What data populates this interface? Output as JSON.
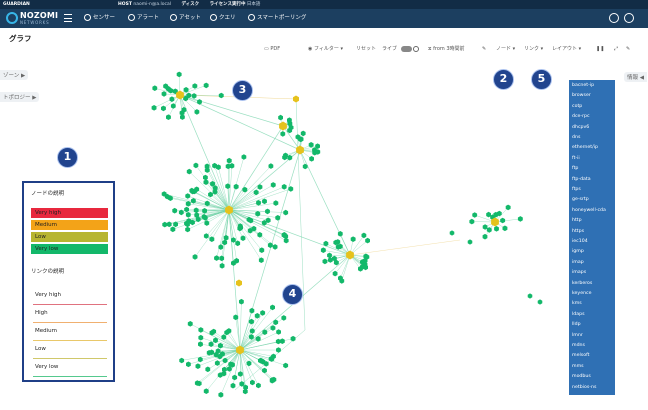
{
  "statusbar": {
    "brand": "GUARDIAN",
    "host_label": "HOST",
    "host_value": "naomi-n@a.local",
    "disk_label": "ディスク",
    "license_label": "ライセンス実行中",
    "language": "日本語"
  },
  "nav": {
    "logo_name": "NOZOMI",
    "logo_sub": "NETWORKS",
    "items": [
      {
        "label": "センサー",
        "icon": "sensor-icon"
      },
      {
        "label": "アラート",
        "icon": "alert-icon"
      },
      {
        "label": "アセット",
        "icon": "asset-icon"
      },
      {
        "label": "クエリ",
        "icon": "query-icon"
      },
      {
        "label": "スマートポーリング",
        "icon": "polling-icon"
      }
    ]
  },
  "page_title": "グラフ",
  "toolbar": {
    "pdf": "PDF",
    "filter": "フィルター ▾",
    "reset": "リセット",
    "live": "ライブ",
    "time": "from 3時間前",
    "node": "ノード ▾",
    "link": "リンク ▾",
    "layout": "レイアウト ▾"
  },
  "left_tabs": {
    "zone": "ゾーン ▶",
    "topology": "トポロジー ▶"
  },
  "right_tab": "情報 ◀",
  "protocols": [
    "bacnet-ip",
    "browser",
    "cotp",
    "dce-rpc",
    "dhcpv6",
    "dns",
    "ethernet/ip",
    "ft-ii",
    "ftp",
    "ftp-data",
    "ftps",
    "ge-srtp",
    "honeywell-cda",
    "http",
    "https",
    "iec104",
    "igmp",
    "imap",
    "imaps",
    "kerberos",
    "keyence",
    "kms",
    "ldaps",
    "lldp",
    "lmnr",
    "mdns",
    "melsoft",
    "mms",
    "modbus",
    "netbios-ns"
  ],
  "legend": {
    "node_title": "ノードの説明",
    "nodes": [
      {
        "label": "Very high",
        "color": "#e8283e"
      },
      {
        "label": "Medium",
        "color": "#f3a318"
      },
      {
        "label": "Low",
        "color": "#b7b530"
      },
      {
        "label": "Very low",
        "color": "#13b86a"
      }
    ],
    "link_title": "リンクの説明",
    "links": [
      {
        "label": "Very high",
        "color": "#e0727f"
      },
      {
        "label": "High",
        "color": "#f0b070"
      },
      {
        "label": "Medium",
        "color": "#e9c86a"
      },
      {
        "label": "Low",
        "color": "#d0c86a"
      },
      {
        "label": "Very low",
        "color": "#55c98e"
      }
    ]
  },
  "callouts": [
    "1",
    "2",
    "3",
    "4",
    "5"
  ],
  "colors": {
    "node": "#13b86a",
    "hub": "#e6c21c",
    "edge": "#6fd1a6",
    "nav": "#1c3f60",
    "protocol_panel": "#2f70b4",
    "callout": "#21448e"
  }
}
